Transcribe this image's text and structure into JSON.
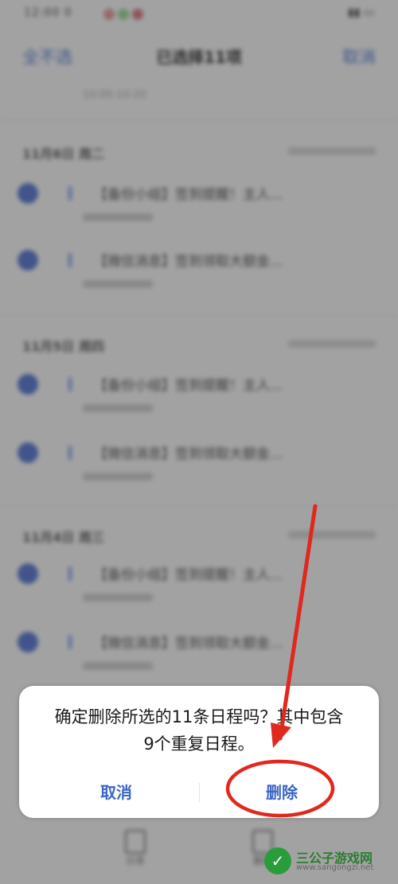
{
  "status_bar": {
    "time": "12:00 0",
    "signal": ""
  },
  "nav": {
    "left_label": "全不选",
    "title": "已选择11项",
    "right_label": "取消"
  },
  "header_time": "10:00-10:20",
  "sections": [
    {
      "date": "11月6日 周二",
      "items": [
        {
          "title": "【备份小组】签到提醒！主人..."
        },
        {
          "title": "【微信消息】签到领取大额金..."
        }
      ]
    },
    {
      "date": "11月5日 周四",
      "items": [
        {
          "title": "【备份小组】签到提醒！主人..."
        },
        {
          "title": "【微信消息】签到领取大额金..."
        }
      ]
    },
    {
      "date": "11月4日 周三",
      "items": [
        {
          "title": "【备份小组】签到提醒！主人..."
        },
        {
          "title": "【微信消息】签到领取大额金..."
        }
      ]
    }
  ],
  "toolbar": {
    "left_label": "分享",
    "right_label": "删除"
  },
  "dialog": {
    "message_line1": "确定删除所选的11条日程吗？其中包含",
    "message_line2": "9个重复日程。",
    "cancel_label": "取消",
    "delete_label": "删除"
  },
  "watermark": {
    "logo_char": "✓",
    "name": "三公子游戏网",
    "url": "www.sangongzi.net"
  },
  "colors": {
    "accent": "#3a66c4",
    "annotation": "#e0281e",
    "check": "#3f61c8"
  }
}
